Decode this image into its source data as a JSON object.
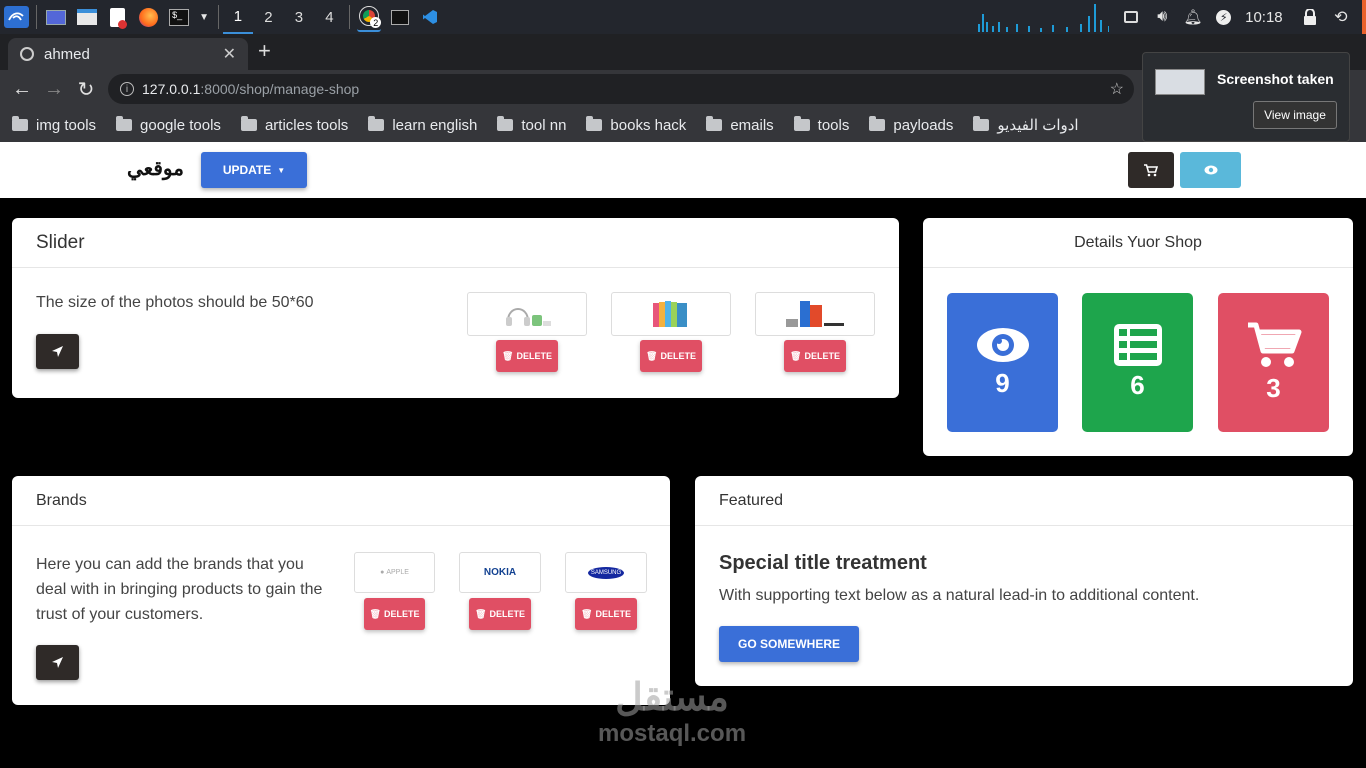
{
  "taskbar": {
    "workspaces": [
      "1",
      "2",
      "3",
      "4"
    ],
    "clock": "10:18",
    "chrome_badge": "2"
  },
  "browser": {
    "tab_title": "ahmed",
    "url_host": "127.0.0.1",
    "url_path": ":8000/shop/manage-shop",
    "bookmarks": [
      "img tools",
      "google tools",
      "articles tools",
      "learn english",
      "tool nn",
      "books hack",
      "emails",
      "tools",
      "payloads",
      "ادوات الفيديو"
    ]
  },
  "toast": {
    "title": "Screenshot taken",
    "view_label": "View image"
  },
  "site": {
    "logo": "موقعي",
    "update_label": "UPDATE"
  },
  "slider": {
    "title": "Slider",
    "text": "The size of the photos should be 50*60",
    "delete_label": "DELETE"
  },
  "details": {
    "title": "Details Yuor Shop",
    "views": "9",
    "lists": "6",
    "orders": "3"
  },
  "brands": {
    "title": "Brands",
    "text": "Here you can add the brands that you deal with in bringing products to gain the trust of your customers.",
    "logos": [
      "APPLE",
      "NOKIA",
      "SAMSUNG"
    ],
    "delete_label": "DELETE"
  },
  "featured": {
    "title": "Featured",
    "heading": "Special title treatment",
    "text": "With supporting text below as a natural lead-in to additional content.",
    "button": "GO SOMEWHERE"
  },
  "watermark": {
    "arabic": "مستقل",
    "latin": "mostaql.com"
  },
  "colors": {
    "primary": "#3a6fd8",
    "success": "#1ea54c",
    "danger": "#e04f64",
    "info": "#5ab8da",
    "dark": "#2f2a28"
  }
}
